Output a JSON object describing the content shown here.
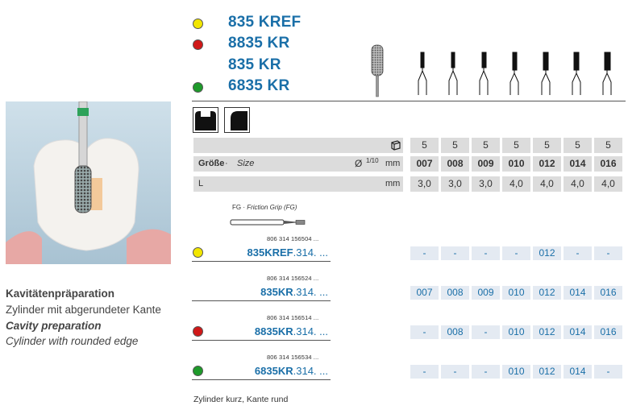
{
  "colors": {
    "blue": "#1a6fa8",
    "yellow": "#f2e600",
    "red": "#d01818",
    "green": "#1e9a2a"
  },
  "products": [
    {
      "code": "835 KREF",
      "dot": "yellow"
    },
    {
      "code": "8835 KR",
      "dot": "red"
    },
    {
      "code": "835 KR",
      "dot": ""
    },
    {
      "code": "6835 KR",
      "dot": "green"
    }
  ],
  "specs": {
    "pack_row": {
      "icon": "pack-icon",
      "values": [
        "5",
        "5",
        "5",
        "5",
        "5",
        "5",
        "5"
      ]
    },
    "size_row": {
      "label": "Größe",
      "sep": " · ",
      "label_en": "Size",
      "unit_sym": "Ø",
      "unit_frac": "1/10",
      "unit_mm": "mm",
      "values": [
        "007",
        "008",
        "009",
        "010",
        "012",
        "014",
        "016"
      ]
    },
    "l_row": {
      "label": "L",
      "unit": "mm",
      "values": [
        "3,0",
        "3,0",
        "3,0",
        "4,0",
        "4,0",
        "4,0",
        "4,0"
      ]
    }
  },
  "fg_label": {
    "prefix": "FG",
    "sep": " · ",
    "text": "Friction Grip (FG)"
  },
  "orders": [
    {
      "ref": "806 314 156504 ...",
      "code": "835KREF",
      "suffix": ".314. ...",
      "dot": "yellow",
      "sizes": [
        "-",
        "-",
        "-",
        "-",
        "012",
        "-",
        "-"
      ]
    },
    {
      "ref": "806 314 156524 ...",
      "code": "835KR",
      "suffix": ".314. ...",
      "dot": "",
      "sizes": [
        "007",
        "008",
        "009",
        "010",
        "012",
        "014",
        "016"
      ]
    },
    {
      "ref": "806 314 156514 ...",
      "code": "8835KR",
      "suffix": ".314. ...",
      "dot": "red",
      "sizes": [
        "-",
        "008",
        "-",
        "010",
        "012",
        "014",
        "016"
      ]
    },
    {
      "ref": "806 314 156534 ...",
      "code": "6835KR",
      "suffix": ".314. ...",
      "dot": "green",
      "sizes": [
        "-",
        "-",
        "-",
        "010",
        "012",
        "014",
        "-"
      ]
    }
  ],
  "description": {
    "de_title": "Kavitätenpräparation",
    "de_sub": "Zylinder mit abgerundeter Kante",
    "en_title": "Cavity preparation",
    "en_sub": "Cylinder with rounded edge"
  },
  "footer": "Zylinder kurz, Kante rund"
}
